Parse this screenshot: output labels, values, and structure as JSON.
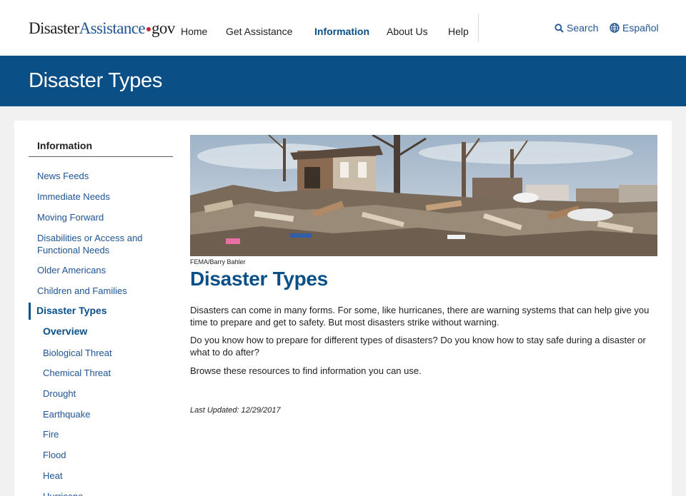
{
  "header": {
    "logo_part1": "Disaster",
    "logo_part2": "Assistance",
    "logo_part3": "gov",
    "nav": [
      "Home",
      "Get Assistance",
      "Information",
      "About Us",
      "Help"
    ],
    "search_label": "Search",
    "language_label": "Español"
  },
  "banner": {
    "title": "Disaster Types"
  },
  "sidebar": {
    "title": "Information",
    "items": [
      "News Feeds",
      "Immediate Needs",
      "Moving Forward",
      "Disabilities or Access and",
      "Functional Needs",
      "Older Americans",
      "Children and Families",
      "Disaster Types",
      "Overview",
      "Biological Threat",
      "Chemical Threat",
      "Drought",
      "Earthquake",
      "Fire",
      "Flood",
      "Heat",
      "Hurricane"
    ]
  },
  "main": {
    "photo_credit": "FEMA/Barry Bahler",
    "heading": "Disaster Types",
    "paragraphs": [
      "Disasters can come in many forms. For some, like hurricanes, there are warning systems that can help give you time to prepare and get to safety. But most disasters strike without warning.",
      "Do you know how to prepare for different types of disasters? Do you know how to stay safe during a disaster or what to do after?",
      "Browse these resources to find information you can use."
    ],
    "last_updated": "Last Updated: 12/29/2017"
  },
  "colors": {
    "brand_blue": "#0b4f87",
    "link_blue": "#205493",
    "logo_dot": "#c9252c"
  }
}
